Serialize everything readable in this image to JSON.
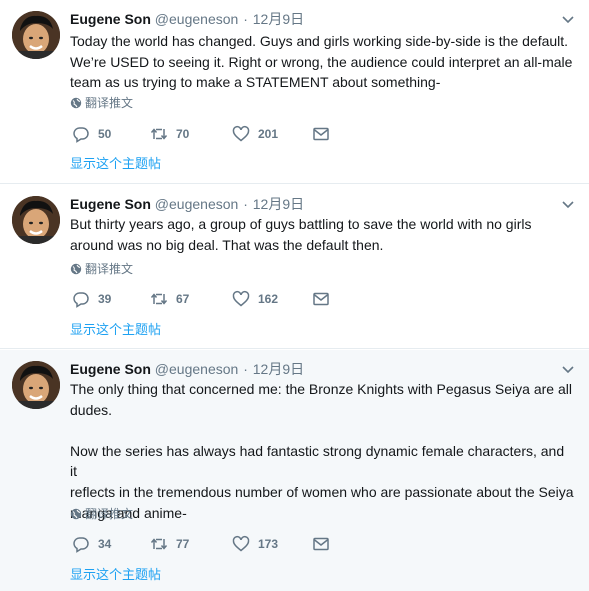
{
  "tweets": [
    {
      "name": "Eugene Son",
      "handle": "@eugeneson",
      "separator": "·",
      "time": "12月9日",
      "text": "Today the world has changed. Guys and girls working side-by-side is the default.\nWe’re USED to seeing it. Right or wrong, the audience could interpret an all-male\nteam as us trying to make a STATEMENT about something-",
      "translate": "翻译推文",
      "replies": "50",
      "retweets": "70",
      "likes": "201",
      "thread_link": "显示这个主题帖"
    },
    {
      "name": "Eugene Son",
      "handle": "@eugeneson",
      "separator": "·",
      "time": "12月9日",
      "text": "But thirty years ago, a group of guys battling to save the world with no girls\naround was no big deal. That was the default then.",
      "translate": "翻译推文",
      "replies": "39",
      "retweets": "67",
      "likes": "162",
      "thread_link": "显示这个主题帖"
    },
    {
      "name": "Eugene Son",
      "handle": "@eugeneson",
      "separator": "·",
      "time": "12月9日",
      "text": "The only thing that concerned me: the Bronze Knights with Pegasus Seiya are all\ndudes.\n\nNow the series has always had fantastic strong dynamic female characters, and it\nreflects in the tremendous number of women who are passionate about the Seiya\nmanga and anime-",
      "translate": "翻译推文",
      "replies": "34",
      "retweets": "77",
      "likes": "173",
      "thread_link": "显示这个主题帖"
    }
  ],
  "icons": {
    "reply": "reply-icon",
    "retweet": "retweet-icon",
    "like": "heart-icon",
    "dm": "envelope-icon",
    "globe": "globe-icon",
    "caret": "chevron-down-icon"
  },
  "colors": {
    "text": "#14171a",
    "muted": "#657786",
    "link": "#1da1f2",
    "divider": "#e6ecf0",
    "highlight_bg": "#f5f8fa"
  }
}
